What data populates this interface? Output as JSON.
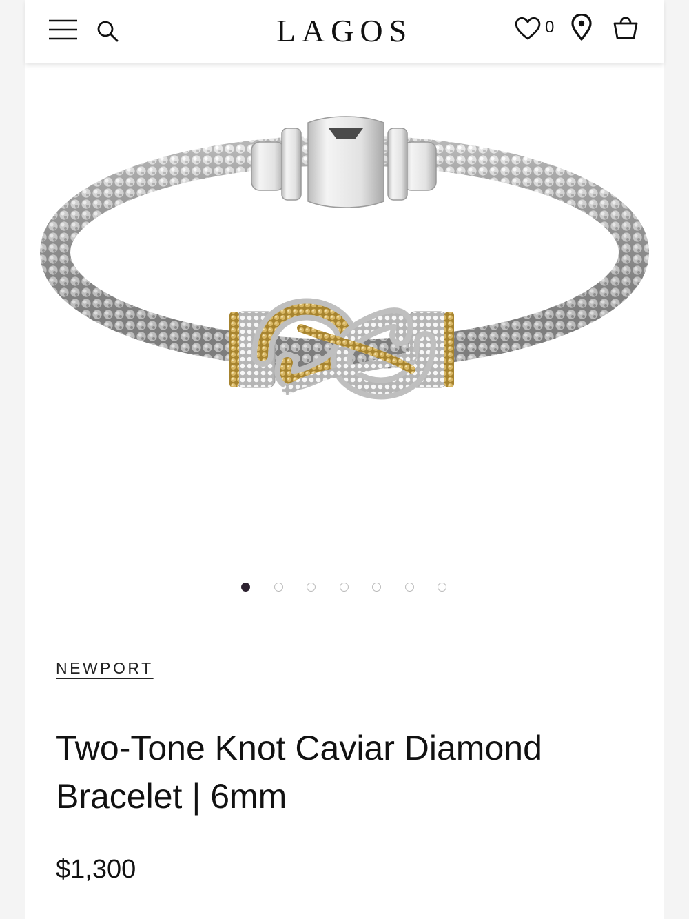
{
  "header": {
    "logo": "LAGOS",
    "menu_icon": "hamburger-menu-icon",
    "search_icon": "search-icon",
    "wishlist_icon": "heart-icon",
    "wishlist_count": "0",
    "location_icon": "location-pin-icon",
    "bag_icon": "shopping-bag-icon"
  },
  "gallery": {
    "image_subject": "bracelet-image",
    "slide_count": 7,
    "active_slide": 1
  },
  "product": {
    "collection": "NEWPORT",
    "title": "Two-Tone Knot Caviar Diamond Bracelet | 6mm",
    "price": "$1,300"
  },
  "colors": {
    "active_dot": "#2d2230",
    "inactive_dot_border": "#b9b9b9",
    "silver": "#c9c9c9",
    "gold": "#c9a452"
  }
}
